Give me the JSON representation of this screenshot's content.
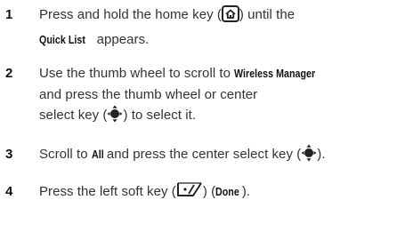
{
  "steps": [
    {
      "number": "1",
      "text_a": "Press and hold the home key (",
      "icon": "home-key-icon",
      "text_b": ") until the",
      "kw_1": "Quick List",
      "text_c": " appears."
    },
    {
      "number": "2",
      "text_a": "Use the thumb wheel to scroll to ",
      "kw_1": "Wireless Manager",
      "text_b": "and press the thumb wheel or center",
      "text_c": "select key (",
      "icon": "center-select-key-icon",
      "text_d": ") to select it."
    },
    {
      "number": "3",
      "text_a": "Scroll to ",
      "kw_1": "All",
      "text_b": " and press the center select key (",
      "icon": "center-select-key-icon",
      "text_c": ")."
    },
    {
      "number": "4",
      "text_a": "Press the left soft key (",
      "icon": "left-soft-key-icon",
      "text_b": ") (",
      "kw_1": "Done",
      "text_c": ")."
    }
  ]
}
